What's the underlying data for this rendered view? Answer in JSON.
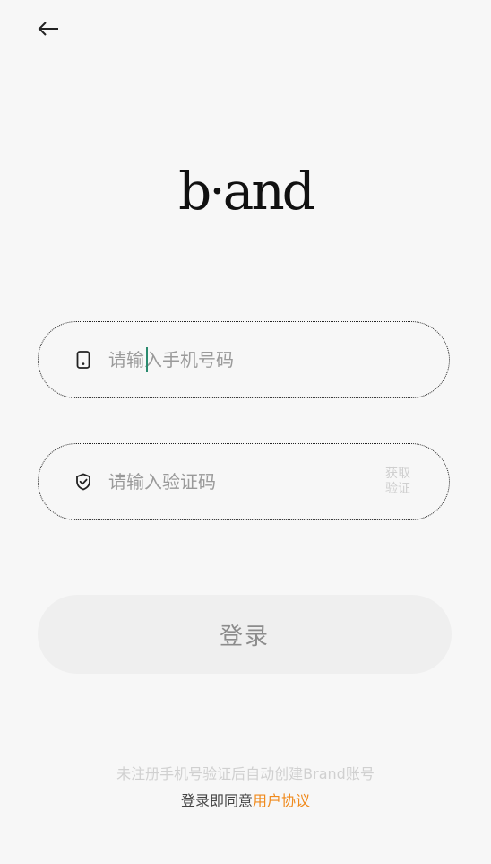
{
  "nav": {
    "back_icon": "arrow-left-icon"
  },
  "brand": {
    "logo_text": "b·and"
  },
  "form": {
    "phone": {
      "icon": "phone-icon",
      "placeholder": "请输入手机号码",
      "value": ""
    },
    "code": {
      "icon": "shield-check-icon",
      "placeholder": "请输入验证码",
      "value": "",
      "get_code_label": "获取验证"
    },
    "login_label": "登录"
  },
  "footer": {
    "notice": "未注册手机号验证后自动创建Brand账号",
    "agree_prefix": "登录即同意",
    "agreement_link": "用户协议"
  },
  "colors": {
    "background": "#f7f7f7",
    "accent_link": "#f08a1c",
    "caret": "#2a8a6e",
    "button_bg": "#efefef"
  }
}
